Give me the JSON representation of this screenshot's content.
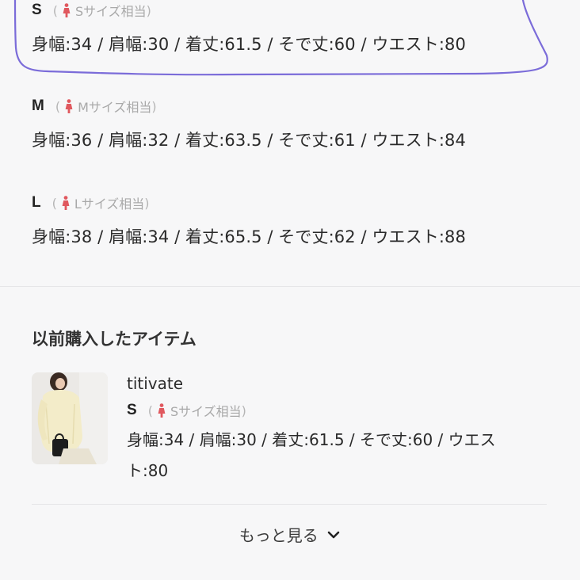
{
  "sizes": [
    {
      "letter": "S",
      "open_paren": "(",
      "equiv": "Sサイズ相当",
      "close_paren": ")",
      "measurements": "身幅:34 / 肩幅:30 / 着丈:61.5 / そで丈:60 / ウエスト:80"
    },
    {
      "letter": "M",
      "open_paren": "(",
      "equiv": "Mサイズ相当",
      "close_paren": ")",
      "measurements": "身幅:36 / 肩幅:32 / 着丈:63.5 / そで丈:61 / ウエスト:84"
    },
    {
      "letter": "L",
      "open_paren": "(",
      "equiv": "Lサイズ相当",
      "close_paren": ")",
      "measurements": "身幅:38 / 肩幅:34 / 着丈:65.5 / そで丈:62 / ウエスト:88"
    }
  ],
  "previous": {
    "title": "以前購入したアイテム",
    "item": {
      "brand": "titivate",
      "size_letter": "S",
      "open_paren": "(",
      "equiv": "Sサイズ相当",
      "close_paren": ")",
      "measurements_line1": "身幅:34 / 肩幅:30 / 着丈:61.5 / そで丈:60 / ウエス",
      "measurements_line2": "ト:80"
    }
  },
  "more_label": "もっと見る",
  "icons": {
    "person": "person-icon",
    "chevron": "chevron-down-icon"
  },
  "colors": {
    "highlight_stroke": "#7b6cd9",
    "person_icon": "#e0585e",
    "background": "#f7f7f8"
  }
}
